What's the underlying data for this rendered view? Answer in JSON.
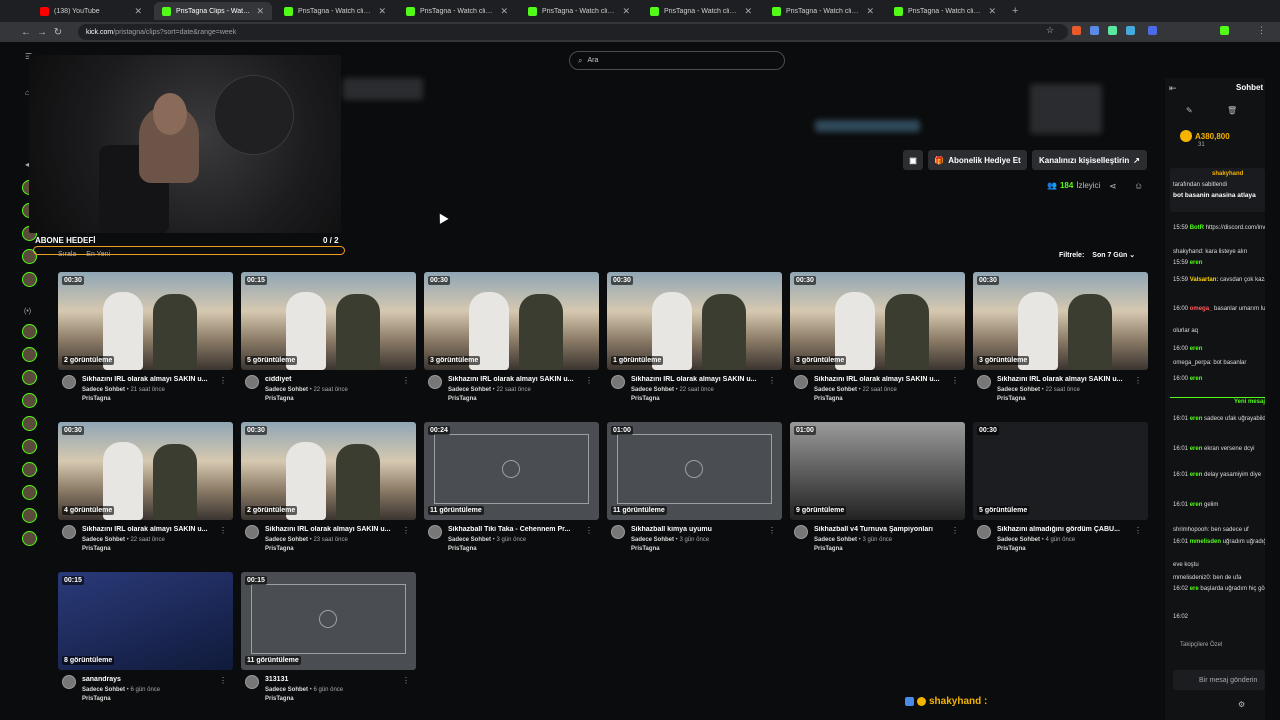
{
  "tabs": [
    {
      "title": "(138) YouTube",
      "icon_color": "#ff0000",
      "active": false
    },
    {
      "title": "PrisTagna Clips - Watch Live on",
      "icon_color": "#53fc18",
      "active": true
    },
    {
      "title": "PrisTagna - Watch clips on Kick",
      "icon_color": "#53fc18",
      "active": false
    },
    {
      "title": "PrisTagna - Watch clips on Kick",
      "icon_color": "#53fc18",
      "active": false
    },
    {
      "title": "PrisTagna - Watch clips on Kick",
      "icon_color": "#53fc18",
      "active": false
    },
    {
      "title": "PrisTagna - Watch clips on Kick",
      "icon_color": "#53fc18",
      "active": false
    },
    {
      "title": "PrisTagna - Watch clips on Kick",
      "icon_color": "#53fc18",
      "active": false
    },
    {
      "title": "PrisTagna - Watch clips on Kick",
      "icon_color": "#53fc18",
      "active": false
    }
  ],
  "address": {
    "host": "kick.com",
    "path": "/pristagna/clips?sort=date&range=week"
  },
  "search": {
    "placeholder": "Ara"
  },
  "channel_actions": {
    "gift_sub": "Abonelik Hediye Et",
    "customize": "Kanalınızı kişiselleştirin",
    "viewer_count": "184",
    "viewer_label": "İzleyici"
  },
  "sub_goal": {
    "label": "ABONE HEDEFİ",
    "progress": "0 / 2",
    "progress_value": 0
  },
  "sort": {
    "label": "Sırala",
    "value": "En Yeni"
  },
  "filter": {
    "label": "Filtrele:",
    "value": "Son 7 Gün"
  },
  "clips": [
    {
      "duration": "00:30",
      "views": "2 görüntüleme",
      "title": "Sikhazını IRL olarak almayı SAKIN u...",
      "category": "Sadece Sohbet",
      "age": "21 saat önce",
      "author": "PrisTagna",
      "thumb": "room"
    },
    {
      "duration": "00:15",
      "views": "5 görüntüleme",
      "title": "ciddiyet",
      "category": "Sadece Sohbet",
      "age": "22 saat önce",
      "author": "PrisTagna",
      "thumb": "room"
    },
    {
      "duration": "00:30",
      "views": "3 görüntüleme",
      "title": "Sikhazını IRL olarak almayı SAKIN u...",
      "category": "Sadece Sohbet",
      "age": "22 saat önce",
      "author": "PrisTagna",
      "thumb": "room"
    },
    {
      "duration": "00:30",
      "views": "1 görüntüleme",
      "title": "Sikhazını IRL olarak almayı SAKIN u...",
      "category": "Sadece Sohbet",
      "age": "22 saat önce",
      "author": "PrisTagna",
      "thumb": "room"
    },
    {
      "duration": "00:30",
      "views": "3 görüntüleme",
      "title": "Sikhazını IRL olarak almayı SAKIN u...",
      "category": "Sadece Sohbet",
      "age": "22 saat önce",
      "author": "PrisTagna",
      "thumb": "room"
    },
    {
      "duration": "00:30",
      "views": "3 görüntüleme",
      "title": "Sikhazını IRL olarak almayı SAKIN u...",
      "category": "Sadece Sohbet",
      "age": "22 saat önce",
      "author": "PrisTagna",
      "thumb": "room"
    },
    {
      "duration": "00:30",
      "views": "4 görüntüleme",
      "title": "Sikhazını IRL olarak almayı SAKIN u...",
      "category": "Sadece Sohbet",
      "age": "22 saat önce",
      "author": "PrisTagna",
      "thumb": "room"
    },
    {
      "duration": "00:30",
      "views": "2 görüntüleme",
      "title": "Sikhazını IRL olarak almayı SAKIN u...",
      "category": "Sadece Sohbet",
      "age": "23 saat önce",
      "author": "PrisTagna",
      "thumb": "room"
    },
    {
      "duration": "00:24",
      "views": "11 görüntüleme",
      "title": "Sikhazball Tiki Taka - Cehennem Pr...",
      "category": "Sadece Sohbet",
      "age": "3 gün önce",
      "author": "PrisTagna",
      "thumb": "game"
    },
    {
      "duration": "01:00",
      "views": "11 görüntüleme",
      "title": "Sikhazball kimya uyumu",
      "category": "Sadece Sohbet",
      "age": "3 gün önce",
      "author": "PrisTagna",
      "thumb": "game"
    },
    {
      "duration": "01:00",
      "views": "9 görüntüleme",
      "title": "Sikhazball v4 Turnuva Şampiyonları",
      "category": "Sadece Sohbet",
      "age": "3 gün önce",
      "author": "PrisTagna",
      "thumb": "bw"
    },
    {
      "duration": "00:30",
      "views": "5 görüntüleme",
      "title": "Sikhazını almadığını gördüm ÇABU...",
      "category": "Sadece Sohbet",
      "age": "4 gün önce",
      "author": "PrisTagna",
      "thumb": "dark"
    },
    {
      "duration": "00:15",
      "views": "8 görüntüleme",
      "title": "sanandrays",
      "category": "Sadece Sohbet",
      "age": "6 gün önce",
      "author": "PrisTagna",
      "thumb": "blueish"
    },
    {
      "duration": "00:15",
      "views": "11 görüntüleme",
      "title": "313131",
      "category": "Sadece Sohbet",
      "age": "6 gün önce",
      "author": "PrisTagna",
      "thumb": "game"
    }
  ],
  "chat": {
    "title": "Sohbet",
    "points": "A380,800",
    "points_sub": "31",
    "pinned": {
      "user": "shakyhand",
      "pinned_by": "tarafından sabitlendi",
      "text": "bot basanin anasina atlaya"
    },
    "messages": [
      {
        "time": "15:59",
        "user": "BotR",
        "text": "https://discord.com/invite/Pr",
        "user_color": "#53fc18"
      },
      {
        "time": "",
        "user": "",
        "text": "shakyhand: kara listeye alın",
        "user_color": "#aaaaaa"
      },
      {
        "time": "15:59",
        "user": "eren",
        "text": "",
        "user_color": "#53fc18"
      },
      {
        "time": "15:59",
        "user": "Valsartan:",
        "text": "cavsdan çok kazanıyormuş",
        "user_color": "#ffd400"
      },
      {
        "time": "16:00",
        "user": "omega_",
        "text": "basanlar umarım lut kavmi gi",
        "user_color": "#ff5a5a"
      },
      {
        "time": "",
        "user": "",
        "text": "olurlar aq",
        "user_color": "#aaaaaa"
      },
      {
        "time": "",
        "user": "",
        "text": "omega_perpa: bot basanlar",
        "user_color": "#aaaaaa"
      },
      {
        "time": "16:00",
        "user": "eren",
        "text": "",
        "user_color": "#53fc18"
      },
      {
        "time": "16:00",
        "user": "eren",
        "text": "",
        "user_color": "#53fc18"
      },
      {
        "time": "16:01",
        "user": "eren",
        "text": "sadece ufak uğrayabildim so",
        "user_color": "#53fc18"
      },
      {
        "time": "16:01",
        "user": "eren",
        "text": "ekran versene dcyi",
        "user_color": "#53fc18"
      },
      {
        "time": "16:01",
        "user": "eren",
        "text": "delay yasamiyim diye",
        "user_color": "#53fc18"
      },
      {
        "time": "16:01",
        "user": "eren",
        "text": "gelim",
        "user_color": "#53fc18"
      },
      {
        "time": "",
        "user": "",
        "text": "shrimhopooh: ben sadece uf",
        "user_color": "#aaaaaa"
      },
      {
        "time": "16:01",
        "user": "mmelisden",
        "text": "uğradım uğradığım sırada ya",
        "user_color": "#53fc18"
      },
      {
        "time": "",
        "user": "",
        "text": "eve koştu",
        "user_color": "#aaaaaa"
      },
      {
        "time": "",
        "user": "",
        "text": "mmelisdeniz0: ben de ufa",
        "user_color": "#aaaaaa"
      },
      {
        "time": "16:02",
        "user": "ere",
        "text": "başlarda uğradım hiç görmec",
        "user_color": "#53fc18"
      },
      {
        "time": "16:02",
        "user": "",
        "text": "",
        "user_color": "#53fc18"
      }
    ],
    "new_messages": "Yeni mesaj",
    "followers_only": "Takipçilere Özel",
    "input_placeholder": "Bir mesaj gönderin"
  },
  "bottom_user": "shakyhand :"
}
